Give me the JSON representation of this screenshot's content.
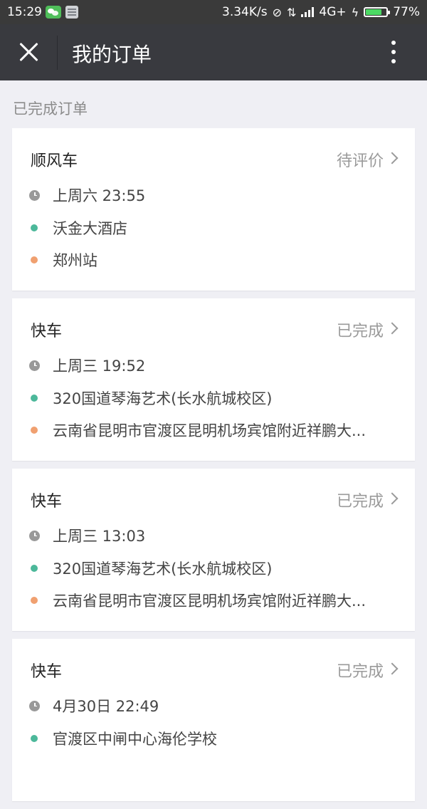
{
  "status_bar": {
    "time": "15:29",
    "speed": "3.34K/s",
    "network": "4G+",
    "battery": "77%",
    "battery_level": 0.77
  },
  "header": {
    "title": "我的订单"
  },
  "section_label": "已完成订单",
  "orders": [
    {
      "type": "顺风车",
      "status": "待评价",
      "time": "上周六 23:55",
      "start": "沃金大酒店",
      "end": "郑州站"
    },
    {
      "type": "快车",
      "status": "已完成",
      "time": "上周三 19:52",
      "start": "320国道琴海艺术(长水航城校区)",
      "end": "云南省昆明市官渡区昆明机场宾馆附近祥鹏大..."
    },
    {
      "type": "快车",
      "status": "已完成",
      "time": "上周三 13:03",
      "start": "320国道琴海艺术(长水航城校区)",
      "end": "云南省昆明市官渡区昆明机场宾馆附近祥鹏大..."
    },
    {
      "type": "快车",
      "status": "已完成",
      "time": "4月30日 22:49",
      "start": "官渡区中闸中心海伦学校"
    }
  ],
  "colors": {
    "status_bar_bg": "#3a3a3a",
    "header_bg": "#393a3f",
    "page_bg": "#efeff4",
    "start_dot": "#4cb89a",
    "end_dot": "#f0a070",
    "time_dot": "#999999",
    "battery_fill": "#4cd964"
  }
}
